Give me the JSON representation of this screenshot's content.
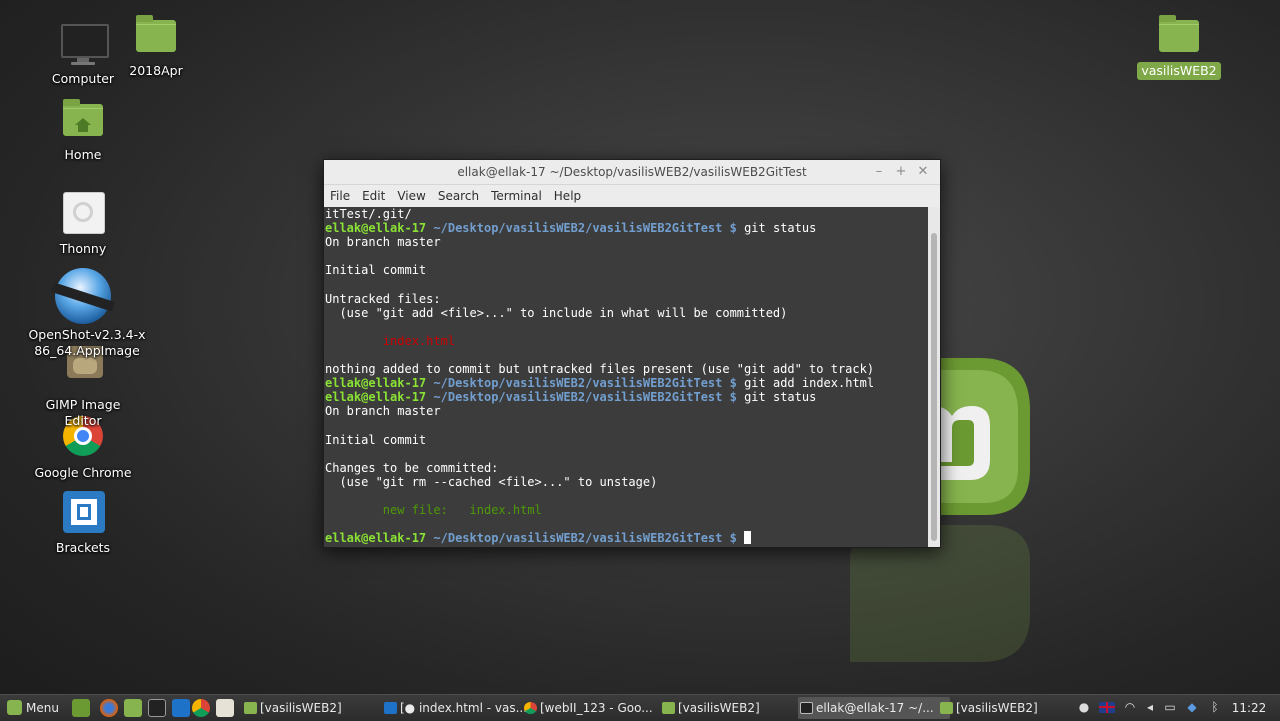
{
  "desktop": {
    "icons": [
      {
        "label": "Computer"
      },
      {
        "label": "2018Apr"
      },
      {
        "label": "Home"
      },
      {
        "label": "Thonny"
      },
      {
        "label": "OpenShot-v2.3.4-x86_64.AppImage"
      },
      {
        "label": "GIMP Image Editor"
      },
      {
        "label": "Google Chrome"
      },
      {
        "label": "Brackets"
      },
      {
        "label": "vasilisWEB2"
      }
    ]
  },
  "terminal": {
    "title": "ellak@ellak-17 ~/Desktop/vasilisWEB2/vasilisWEB2GitTest",
    "menu": [
      "File",
      "Edit",
      "View",
      "Search",
      "Terminal",
      "Help"
    ],
    "user": "ellak@ellak-17",
    "path": "~/Desktop/vasilisWEB2/vasilisWEB2GitTest",
    "prompt_symbol": "$",
    "lines": {
      "l0": "itTest/.git/",
      "l1_cmd": "git status",
      "l2": "On branch master",
      "l4": "Initial commit",
      "l6": "Untracked files:",
      "l7": "  (use \"git add <file>...\" to include in what will be committed)",
      "l9": "index.html",
      "l11": "nothing added to commit but untracked files present (use \"git add\" to track)",
      "l12_cmd": "git add index.html",
      "l13_cmd": "git status",
      "l14": "On branch master",
      "l16": "Initial commit",
      "l18": "Changes to be committed:",
      "l19": "  (use \"git rm --cached <file>...\" to unstage)",
      "l21_label": "new file:",
      "l21_file": "index.html"
    }
  },
  "taskbar": {
    "menu_label": "Menu",
    "tasks": [
      "[vasilisWEB2]",
      "[● index.html - vas...",
      "[webII_123 - Goo...",
      "[vasilisWEB2]",
      "ellak@ellak-17 ~/...",
      "[vasilisWEB2]"
    ],
    "clock": "11:22"
  },
  "colors": {
    "mint_green": "#87b44e",
    "prompt_user": "#8ae234",
    "prompt_path": "#729fcf",
    "untracked": "#cc0000",
    "staged": "#4e9a06"
  }
}
